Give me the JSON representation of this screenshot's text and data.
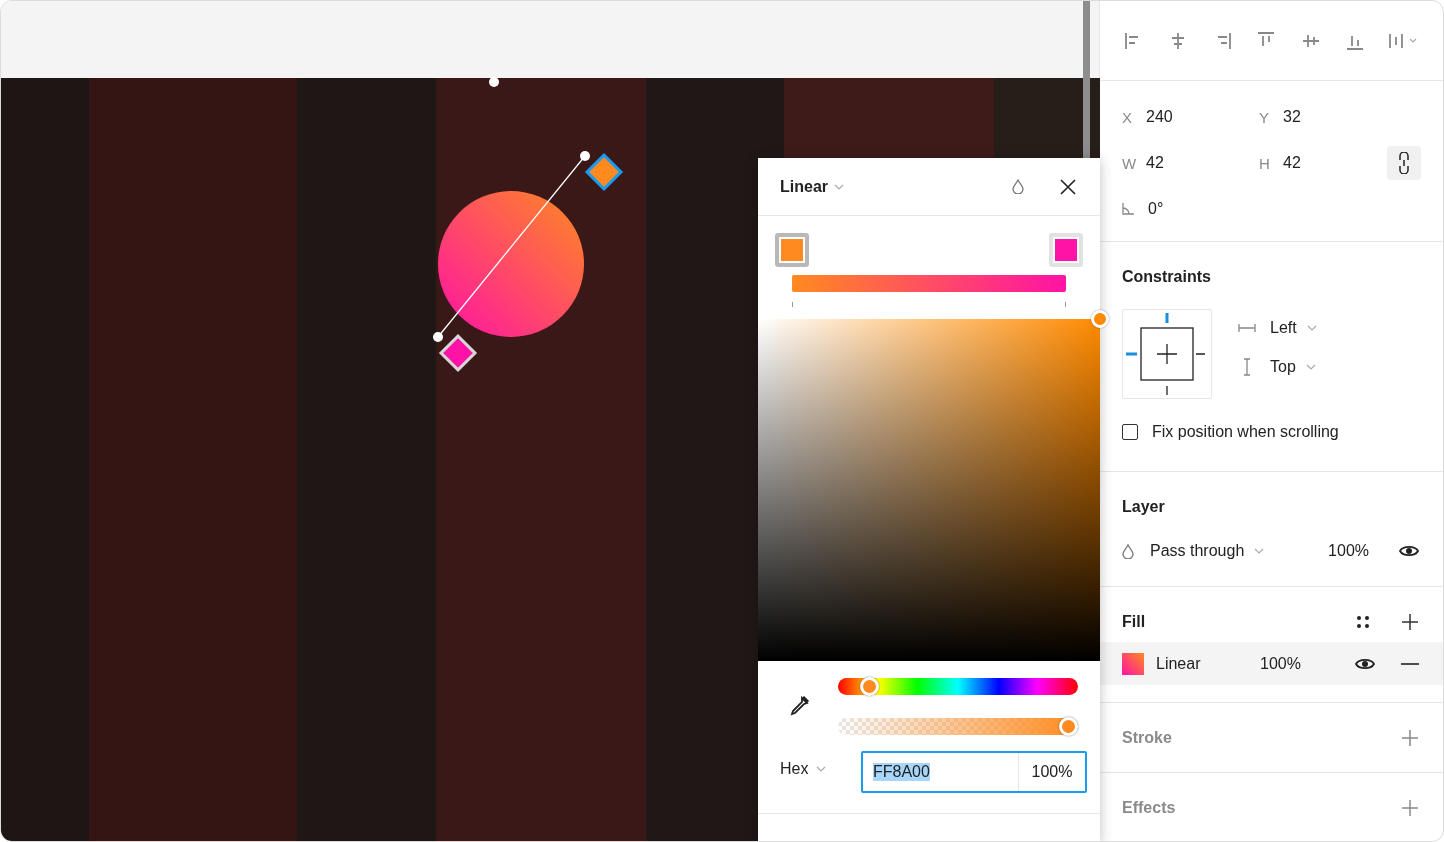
{
  "transform": {
    "fields": [
      {
        "label": "X",
        "value": "240"
      },
      {
        "label": "Y",
        "value": "32"
      },
      {
        "label": "W",
        "value": "42"
      },
      {
        "label": "H",
        "value": "42"
      }
    ],
    "rotation": "0°",
    "constrain_proportions": true
  },
  "constraints": {
    "title": "Constraints",
    "horizontal": "Left",
    "vertical": "Top",
    "fix_position": {
      "label": "Fix position when scrolling",
      "checked": false
    }
  },
  "layer": {
    "title": "Layer",
    "blend": "Pass through",
    "opacity": "100%",
    "visible": true
  },
  "fill": {
    "title": "Fill",
    "items": [
      {
        "type": "Linear",
        "opacity": "100%",
        "visible": true
      }
    ]
  },
  "empty_sections": [
    {
      "title": "Stroke"
    },
    {
      "title": "Effects"
    }
  ],
  "color_picker": {
    "mode": "Linear",
    "stops": [
      {
        "color": "#ff8a1f",
        "selected": true
      },
      {
        "color": "#ff12a6",
        "selected": false
      }
    ],
    "hue": {
      "level": 0.1
    },
    "alpha": {
      "level": 1
    },
    "format": "Hex",
    "hex": "FF8A00",
    "hex_selected": true,
    "opacity": "100%"
  }
}
